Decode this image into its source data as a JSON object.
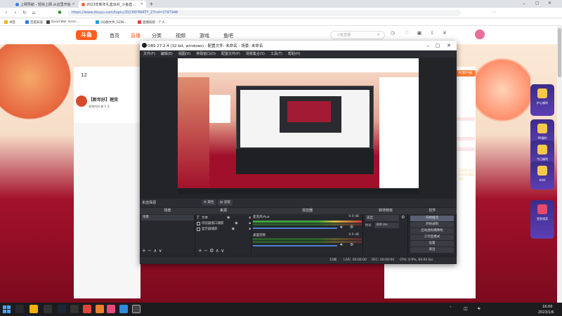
{
  "browser": {
    "tabs": [
      {
        "label": "上网导航 - 轻快上网 从这里开始"
      },
      {
        "label": "2023年新年礼盒派对_斗鱼直..."
      }
    ],
    "url": "https://www.douyu.com/topic/2023NYPARTY_Z?rid=3797946",
    "bookmarks": [
      {
        "label": "书签"
      },
      {
        "label": "百度知道"
      },
      {
        "label": "Dead War Actor..."
      },
      {
        "label": "QQ群文件_SZIN..."
      },
      {
        "label": "直播链接 - 个人..."
      }
    ]
  },
  "site": {
    "logo": "斗鱼",
    "nav": [
      "首页",
      "直播",
      "分类",
      "视频",
      "游戏",
      "鱼吧"
    ],
    "search_placeholder": "斗鱼直播",
    "header_icons": [
      "历史",
      "关注",
      "开播",
      "下载",
      "赚钱"
    ],
    "card": {
      "fans": "12",
      "title": "【新年好】理货",
      "subtitle": "香港时间 剩 0 天"
    },
    "right": {
      "pc_app": "PC客户端",
      "text": "即刻领取福利和礼物",
      "red_text": "更多用户参与新年活动赢取奖励"
    },
    "side_items": [
      "护心福利",
      "PK福利",
      "今日福利",
      "0/40",
      "签到领奖"
    ]
  },
  "obs": {
    "title": "OBS 27.2.4 (32-bit, windows) - 配置文件: 未命名 - 场景: 未命名",
    "menu": [
      "文件(F)",
      "编辑(E)",
      "视图(V)",
      "停靠窗口(D)",
      "配置文件(P)",
      "场景集合(S)",
      "工具(T)",
      "帮助(H)"
    ],
    "no_source": "未选择源",
    "props_btn": "属性",
    "filters_btn": "滤镜",
    "docks": {
      "scenes": "场景",
      "sources": "来源",
      "mixer": "混音器",
      "transitions": "转场特效",
      "controls": "控件"
    },
    "scene_items": [
      "场景"
    ],
    "source_items": [
      "文本",
      "浏览器窗口捕获",
      "显示器捕获"
    ],
    "mixer_tracks": [
      {
        "name": "麦克风/Aux",
        "db": "0.0 dB"
      },
      {
        "name": "桌面音频",
        "db": "0.0 dB"
      }
    ],
    "transition": {
      "type": "淡出",
      "duration_label": "时长",
      "duration": "300 ms"
    },
    "controls": [
      "开始推流",
      "开始录制",
      "启动虚拟摄像机",
      "工作室模式",
      "设置",
      "退出"
    ],
    "status": {
      "live": "LIVE: 00:00:00",
      "rec": "REC: 00:00:00",
      "cpu": "CPU: 0.9%, 60.00 fps",
      "dropped": "12帧"
    }
  },
  "taskbar": {
    "time": "16:00",
    "date": "2023/1/6"
  }
}
